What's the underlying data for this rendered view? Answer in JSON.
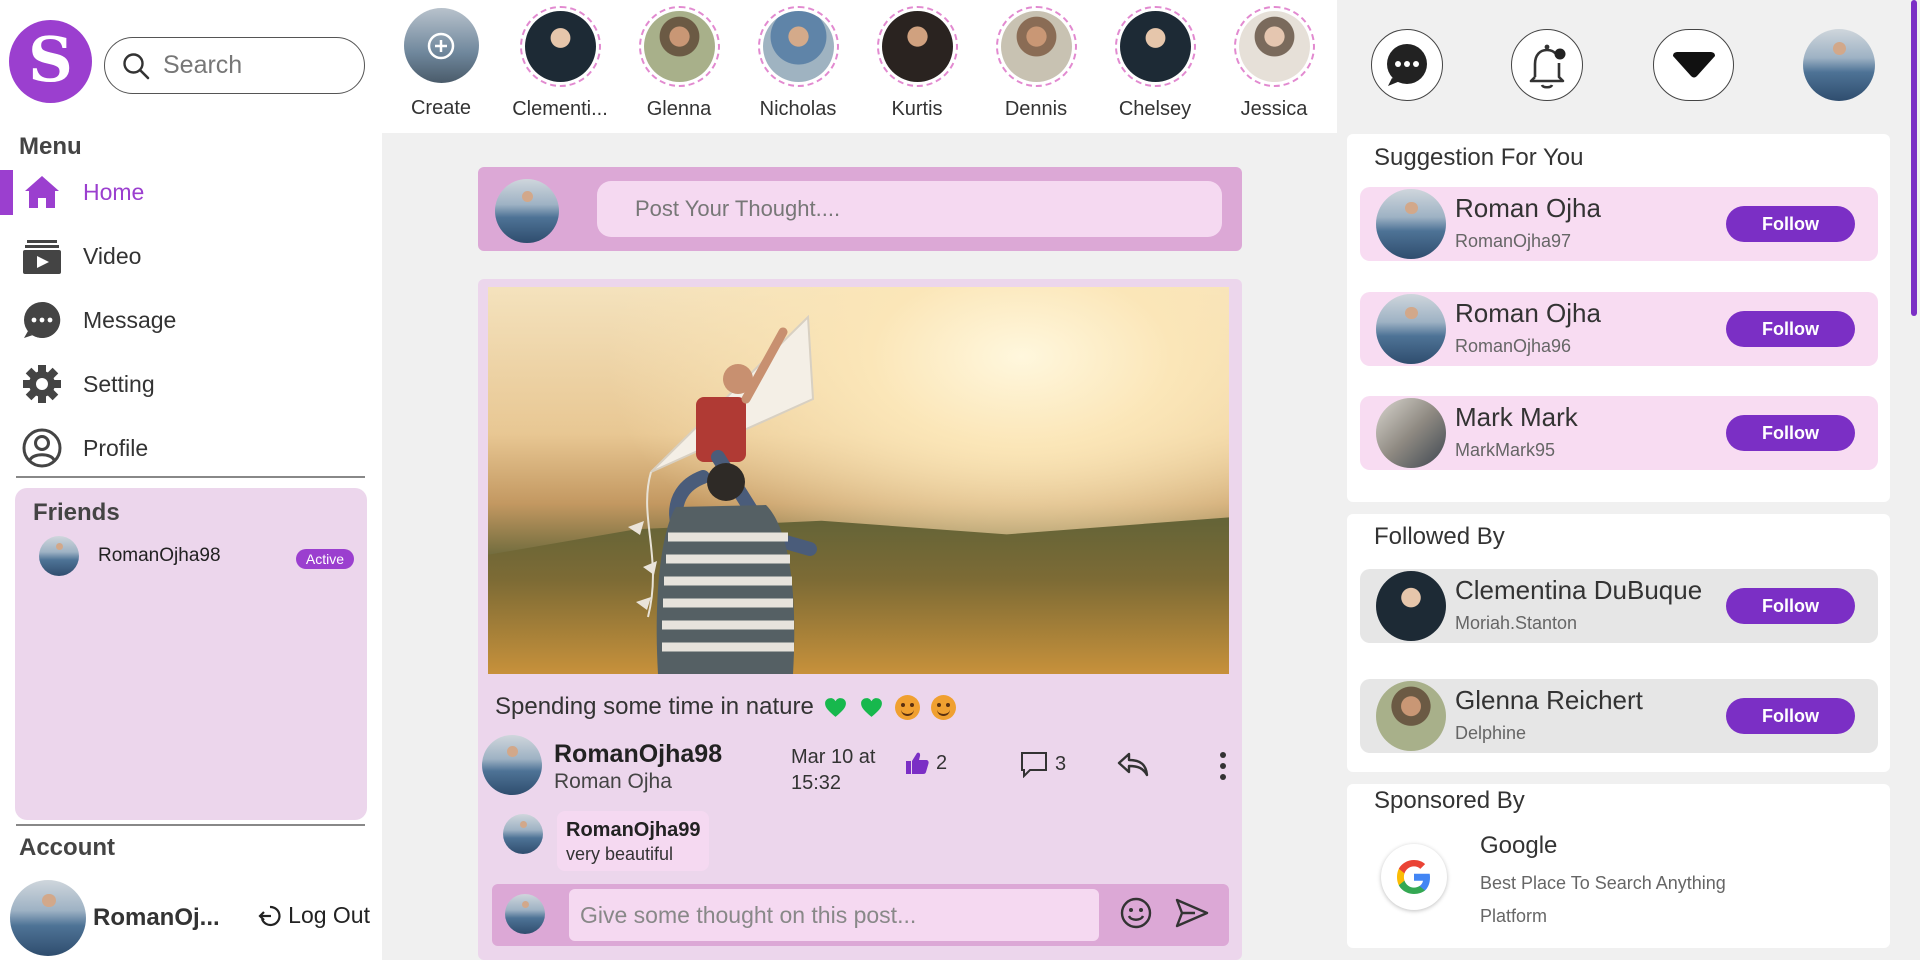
{
  "brand": {
    "logo_letter": "S"
  },
  "search": {
    "placeholder": "Search"
  },
  "menu": {
    "title": "Menu",
    "items": [
      {
        "label": "Home",
        "icon": "home-icon",
        "active": true
      },
      {
        "label": "Video",
        "icon": "video-icon",
        "active": false
      },
      {
        "label": "Message",
        "icon": "message-icon",
        "active": false
      },
      {
        "label": "Setting",
        "icon": "gear-icon",
        "active": false
      },
      {
        "label": "Profile",
        "icon": "user-icon",
        "active": false
      }
    ]
  },
  "friends": {
    "title": "Friends",
    "list": [
      {
        "name": "RomanOjha98",
        "status": "Active"
      }
    ]
  },
  "account": {
    "title": "Account",
    "name": "RomanOj...",
    "logout_label": "Log Out"
  },
  "stories": {
    "create_label": "Create",
    "items": [
      {
        "name": "Clementi..."
      },
      {
        "name": "Glenna"
      },
      {
        "name": "Nicholas"
      },
      {
        "name": "Kurtis"
      },
      {
        "name": "Dennis"
      },
      {
        "name": "Chelsey"
      },
      {
        "name": "Jessica"
      }
    ]
  },
  "composer": {
    "placeholder": "Post Your Thought...."
  },
  "post": {
    "caption": "Spending some time in nature",
    "author_username": "RomanOjha98",
    "author_name": "Roman Ojha",
    "date": "Mar 10 at 15:32",
    "likes": "2",
    "comments": "3",
    "comment": {
      "user": "RomanOjha99",
      "text": "very beautiful"
    },
    "reply_placeholder": "Give some thought on this post..."
  },
  "suggestions": {
    "title": "Suggestion For You",
    "items": [
      {
        "name": "Roman Ojha",
        "handle": "RomanOjha97",
        "button": "Follow"
      },
      {
        "name": "Roman Ojha",
        "handle": "RomanOjha96",
        "button": "Follow"
      },
      {
        "name": "Mark Mark",
        "handle": "MarkMark95",
        "button": "Follow"
      }
    ]
  },
  "followed_by": {
    "title": "Followed By",
    "items": [
      {
        "name": "Clementina DuBuque",
        "handle": "Moriah.Stanton",
        "button": "Follow"
      },
      {
        "name": "Glenna Reichert",
        "handle": "Delphine",
        "button": "Follow"
      }
    ]
  },
  "sponsored": {
    "title": "Sponsored By",
    "name": "Google",
    "description_line1": "Best Place To Search Anything",
    "description_line2": "Platform"
  },
  "colors": {
    "accent": "#9b3fcf",
    "follow_button": "#7b2fc5",
    "card_pink": "#ecd6ec",
    "row_pink": "#f8dcf2"
  }
}
